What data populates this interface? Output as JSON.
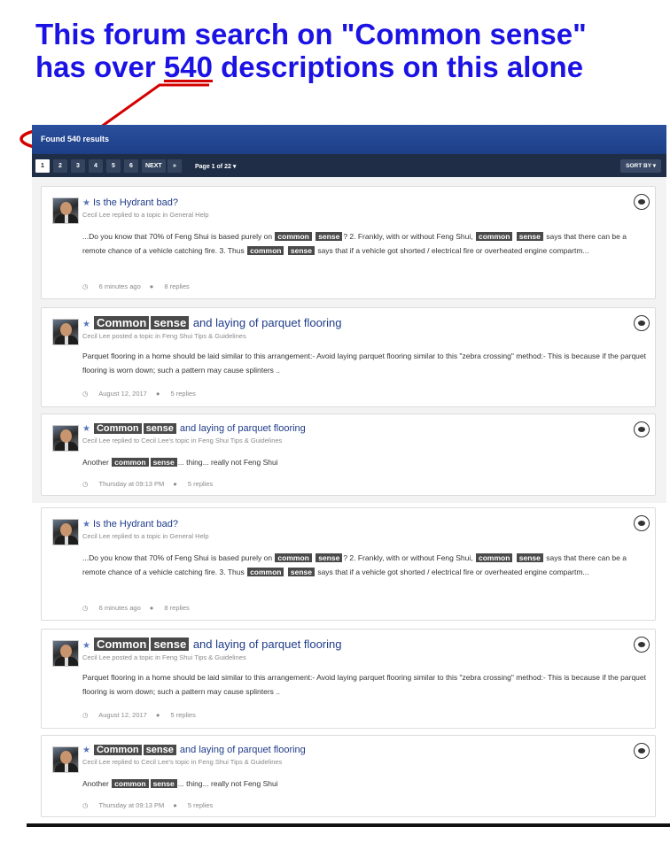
{
  "annotation": {
    "line1": "This forum search on \"Common sense\"",
    "line2_pre": "has over ",
    "line2_num": "540",
    "line2_post": " descriptions on this alone",
    "color": "#1b12e4",
    "accent": "#d40000"
  },
  "results": {
    "found_label": "Found 540 results"
  },
  "pager": {
    "pages": [
      "1",
      "2",
      "3",
      "4",
      "5",
      "6"
    ],
    "next_label": "NEXT",
    "last_label": "»",
    "page_of": "Page 1 of 22",
    "sort_label": "SORT BY"
  },
  "posts": [
    {
      "title": "Is the Hydrant bad?",
      "meta": "Cecil Lee replied to a topic in General Help",
      "snippet_html": "...Do you know that 70% of Feng Shui is based purely on <span class=\"hl\">common</span> <span class=\"hl\">sense</span>? 2. Frankly, with or without Feng Shui, <span class=\"hl\">common</span> <span class=\"hl\">sense</span> says that there can be a remote chance of a vehicle catching fire. 3. Thus <span class=\"hl\">common</span> <span class=\"hl\">sense</span> says that if a vehicle got shorted / electrical fire or overheated engine compartm...",
      "time": "6 minutes ago",
      "replies": "8 replies"
    },
    {
      "title_hl1": "Common",
      "title_hl2": "sense",
      "title_rest": "and laying of parquet flooring",
      "meta": "Cecil Lee posted a topic in Feng Shui Tips & Guidelines",
      "snippet": "Parquet flooring in a home should be laid similar to this arrangement:- Avoid laying parquet flooring similar to this \"zebra crossing\" method:- This is because if the parquet flooring is worn down; such a pattern may cause splinters ..",
      "time": "August 12, 2017",
      "replies": "5 replies"
    },
    {
      "title_hl1": "Common",
      "title_hl2": "sense",
      "title_rest": "and laying of parquet flooring",
      "meta": "Cecil Lee replied to Cecil Lee's topic in Feng Shui Tips & Guidelines",
      "snippet_pre": "Another",
      "snippet_hl1": "common",
      "snippet_hl2": "sense",
      "snippet_post": "... thing... really not Feng Shui",
      "time": "Thursday at 09:13 PM",
      "replies": "5 replies"
    }
  ]
}
